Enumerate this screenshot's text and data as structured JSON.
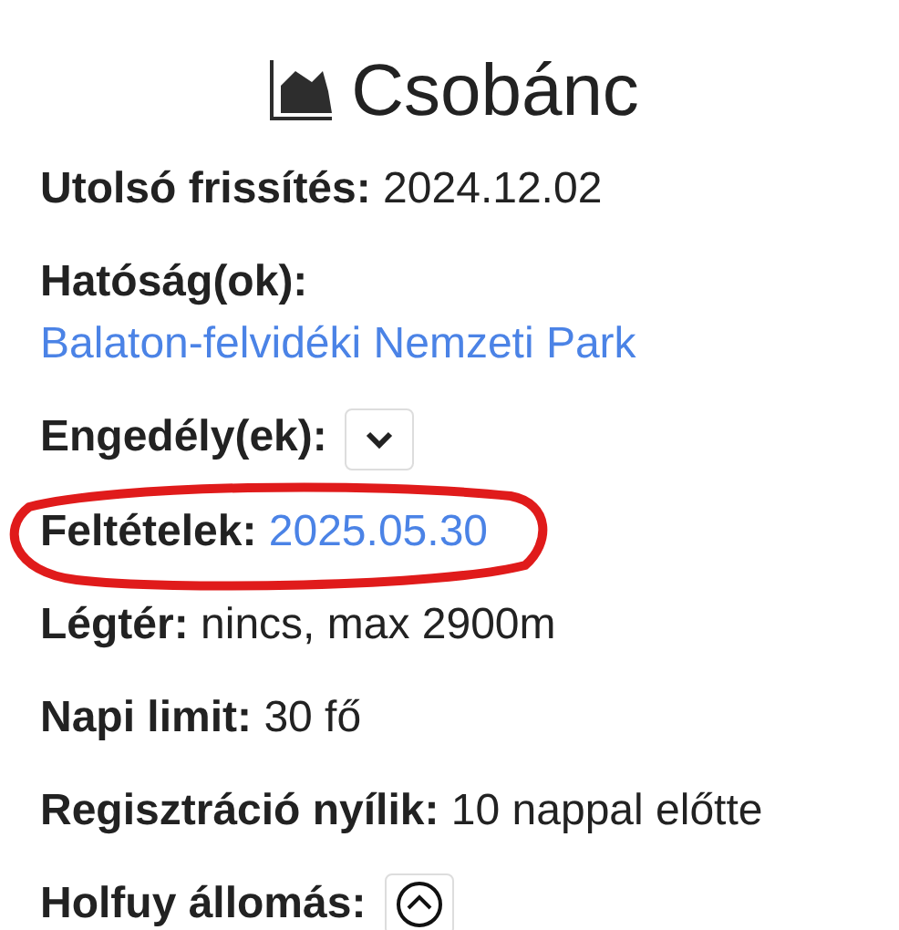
{
  "title": "Csobánc",
  "rows": [
    {
      "kind": "text",
      "label": "Utolsó frissítés:",
      "value": "2024.12.02",
      "highlighted": false
    },
    {
      "kind": "link",
      "label": "Hatóság(ok):",
      "value": "Balaton-felvidéki Nemzeti Park",
      "highlighted": false
    },
    {
      "kind": "dropdown",
      "label": "Engedély(ek):",
      "highlighted": false
    },
    {
      "kind": "link",
      "label": "Feltételek:",
      "value": "2025.05.30",
      "highlighted": true
    },
    {
      "kind": "text",
      "label": "Légtér:",
      "value": "nincs, max 2900m",
      "highlighted": false
    },
    {
      "kind": "text",
      "label": "Napi limit:",
      "value": "30 fő",
      "highlighted": false
    },
    {
      "kind": "text",
      "label": "Regisztráció nyílik:",
      "value": "10 nappal előtte",
      "highlighted": false
    },
    {
      "kind": "station",
      "label": "Holfuy állomás:",
      "highlighted": false
    }
  ]
}
